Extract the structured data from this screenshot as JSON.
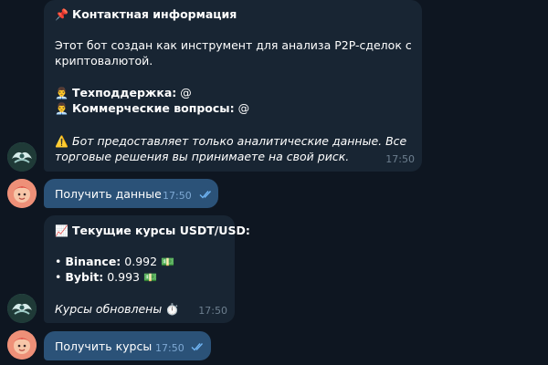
{
  "contact_message": {
    "title_icon": "📌",
    "title": "Контактная информация",
    "desc_line1": "Этот бот создан как инструмент для анализа P2P-сделок с",
    "desc_line2": "криптовалютой.",
    "support_icon": "👨‍💼",
    "support_label": "Техподдержка:",
    "support_value": " @",
    "commercial_icon": "👨‍💼",
    "commercial_label": "Коммерческие вопросы:",
    "commercial_value": " @",
    "warning_icon": "⚠️",
    "warning_line1": "Бот предоставляет только аналитические данные. Все",
    "warning_line2": "торговые решения вы принимаете на свой риск.",
    "time": "17:50"
  },
  "user_message_1": {
    "text": "Получить данные",
    "time": "17:50"
  },
  "rates_message": {
    "title_icon": "📈",
    "title": "Текущие курсы USDT/USD:",
    "binance_label": "Binance:",
    "binance_value": " 0.992",
    "bybit_label": "Bybit:",
    "bybit_value": " 0.993",
    "money_icon": "💵",
    "updated_text": "Курсы обновлены",
    "updated_icon": "⏱️",
    "time": "17:50"
  },
  "user_message_2": {
    "text": "Получить курсы",
    "time": "17:50"
  },
  "colors": {
    "background": "#0e1621",
    "incoming_bubble": "#182533",
    "outgoing_bubble": "#2b5278",
    "read_checks": "#6fb3f2"
  }
}
